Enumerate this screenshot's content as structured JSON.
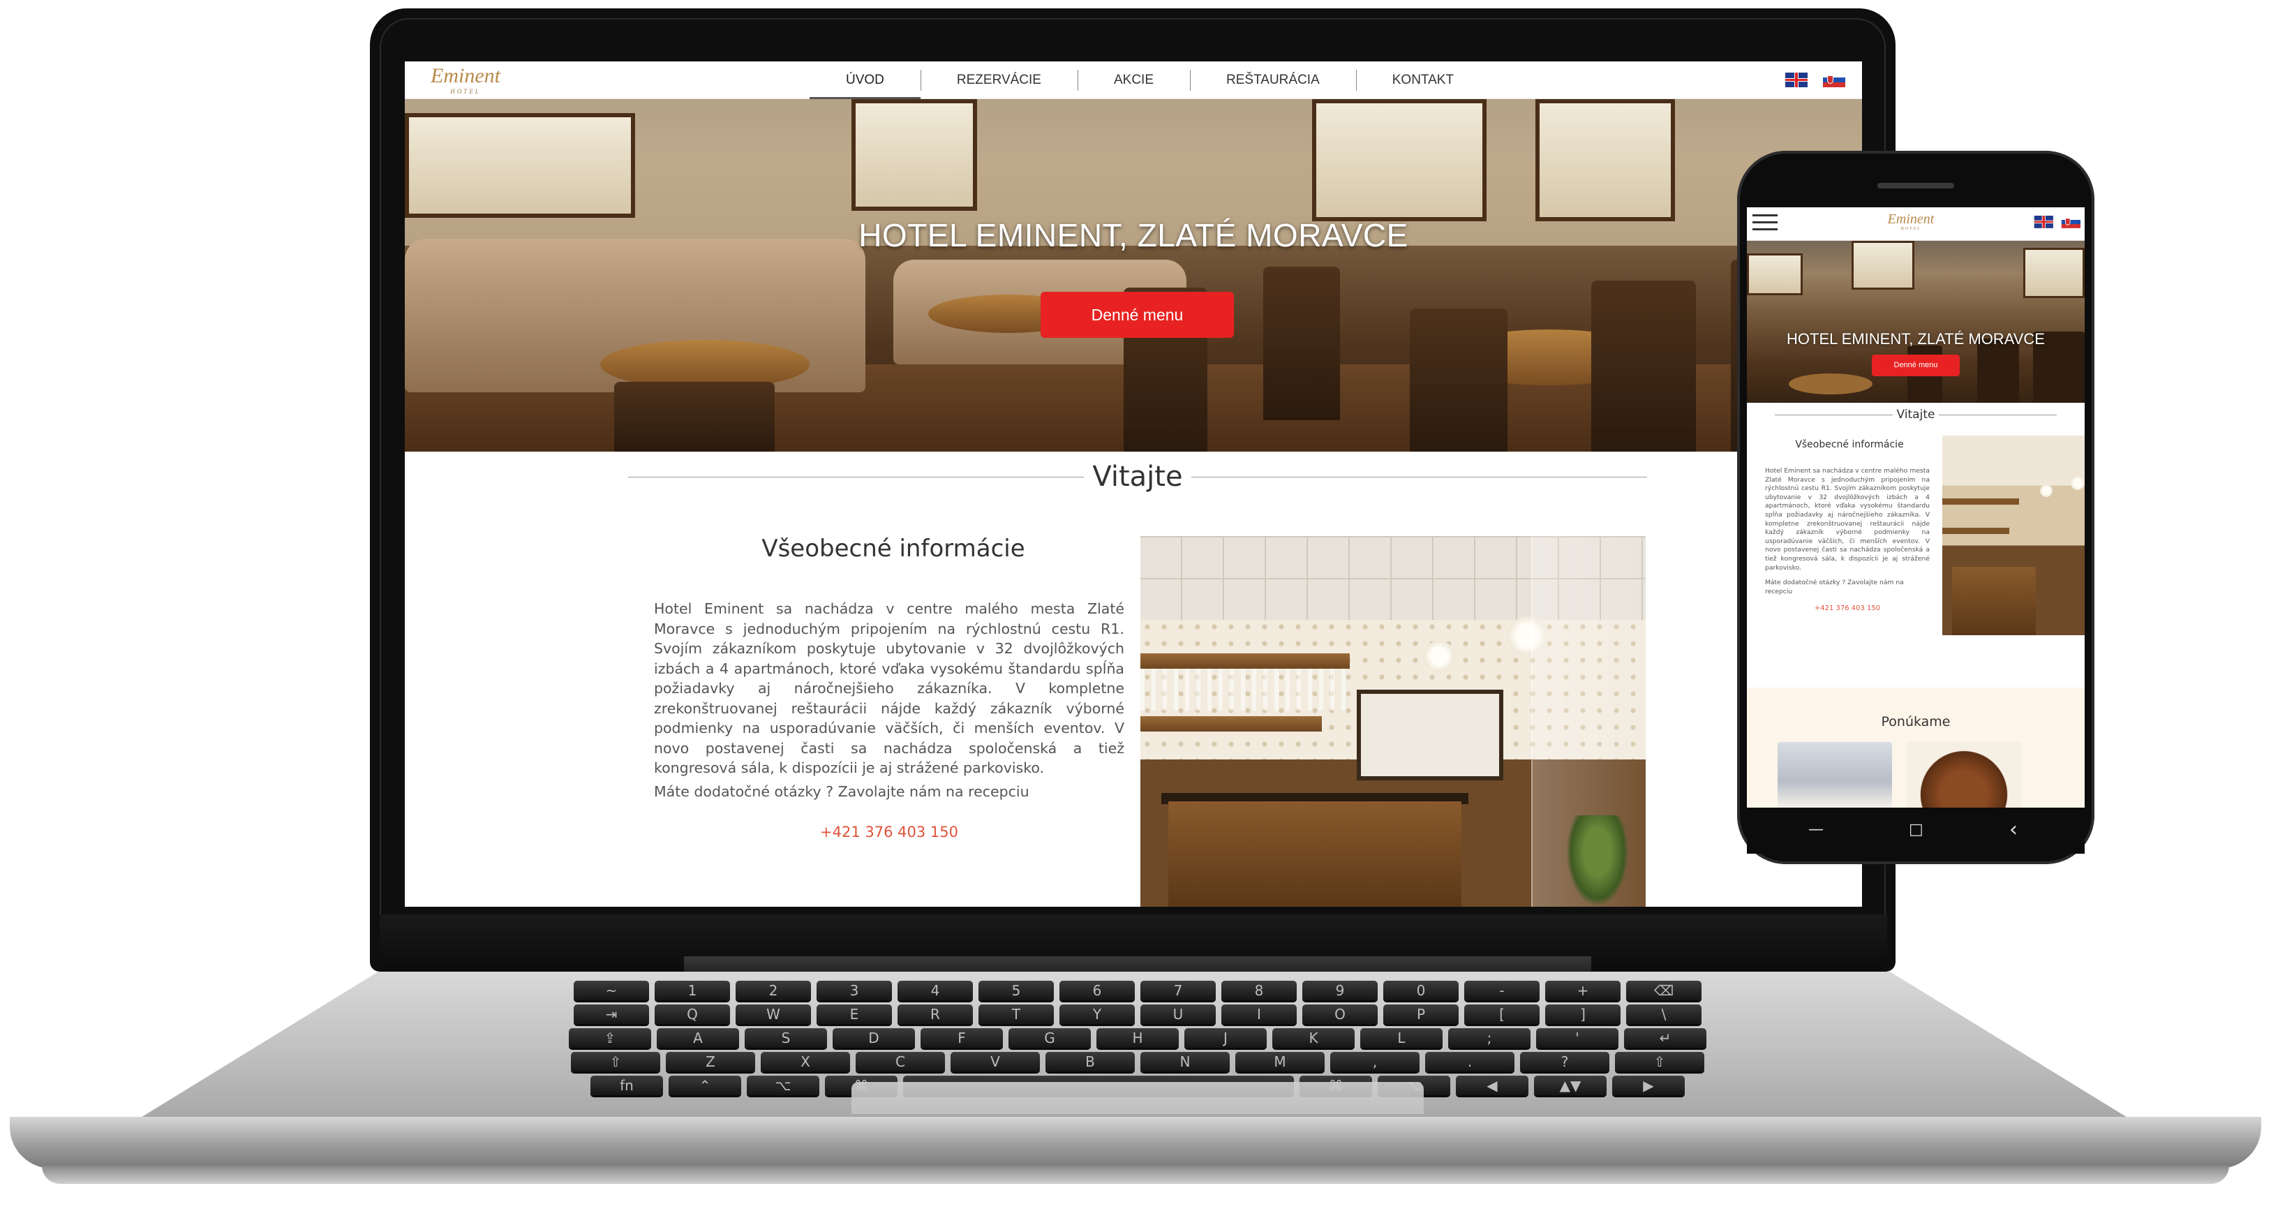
{
  "site": {
    "logo_main": "Eminent",
    "logo_sub": "HOTEL",
    "nav": [
      {
        "label": "ÚVOD",
        "active": true
      },
      {
        "label": "REZERVÁCIE",
        "active": false
      },
      {
        "label": "AKCIE",
        "active": false
      },
      {
        "label": "REŠTAURÁCIA",
        "active": false
      },
      {
        "label": "KONTAKT",
        "active": false
      }
    ],
    "languages": [
      "en-flag-icon",
      "sk-flag-icon"
    ],
    "hero_title": "HOTEL EMINENT, ZLATÉ MORAVCE",
    "hero_button": "Denné menu",
    "welcome_title": "Vitajte",
    "info_title": "Všeobecné informácie",
    "info_text": "Hotel Eminent sa nachádza v centre malého mesta Zlaté Moravce s jednoduchým pripojením na rýchlostnú cestu R1. Svojím zákazníkom poskytuje ubytovanie v 32 dvojlôžkových izbách a 4 apartmánoch, ktoré vďaka vysokému štandardu spĺňa požiadavky aj náročnejšieho zákazníka. V kompletne zrekonštruovanej reštaurácii nájde každý zákazník výborné podmienky na usporadúvanie väčších, či menších eventov. V novo postavenej časti sa nachádza spoločenská a tiež kongresová sála, k dispozícii je aj strážené parkovisko.",
    "info_question": "Máte dodatočné otázky ? Zavolajte nám na recepciu",
    "info_phone": "+421 376 403 150",
    "offer_title": "Ponúkame"
  },
  "colors": {
    "accent_red": "#e82222",
    "phone_link": "#e0533a",
    "logo_gold": "#b8894a",
    "offer_bg": "#fdf5ea"
  },
  "keyboard": {
    "row1": [
      "~",
      "1",
      "2",
      "3",
      "4",
      "5",
      "6",
      "7",
      "8",
      "9",
      "0",
      "-",
      "+",
      "⌫"
    ],
    "row2": [
      "⇥",
      "Q",
      "W",
      "E",
      "R",
      "T",
      "Y",
      "U",
      "I",
      "O",
      "P",
      "[",
      "]",
      "\\"
    ],
    "row3": [
      "⇪",
      "A",
      "S",
      "D",
      "F",
      "G",
      "H",
      "J",
      "K",
      "L",
      ";",
      "'",
      "↵"
    ],
    "row4": [
      "⇧",
      "Z",
      "X",
      "C",
      "V",
      "B",
      "N",
      "M",
      ",",
      ".",
      "?",
      "⇧"
    ],
    "row5": [
      "fn",
      "⌃",
      "⌥",
      "⌘",
      "",
      "⌘",
      "⌥",
      "◀",
      "▲▼",
      "▶"
    ]
  },
  "phone_nav": {
    "recent": "—",
    "home": "□",
    "back": "‹"
  }
}
